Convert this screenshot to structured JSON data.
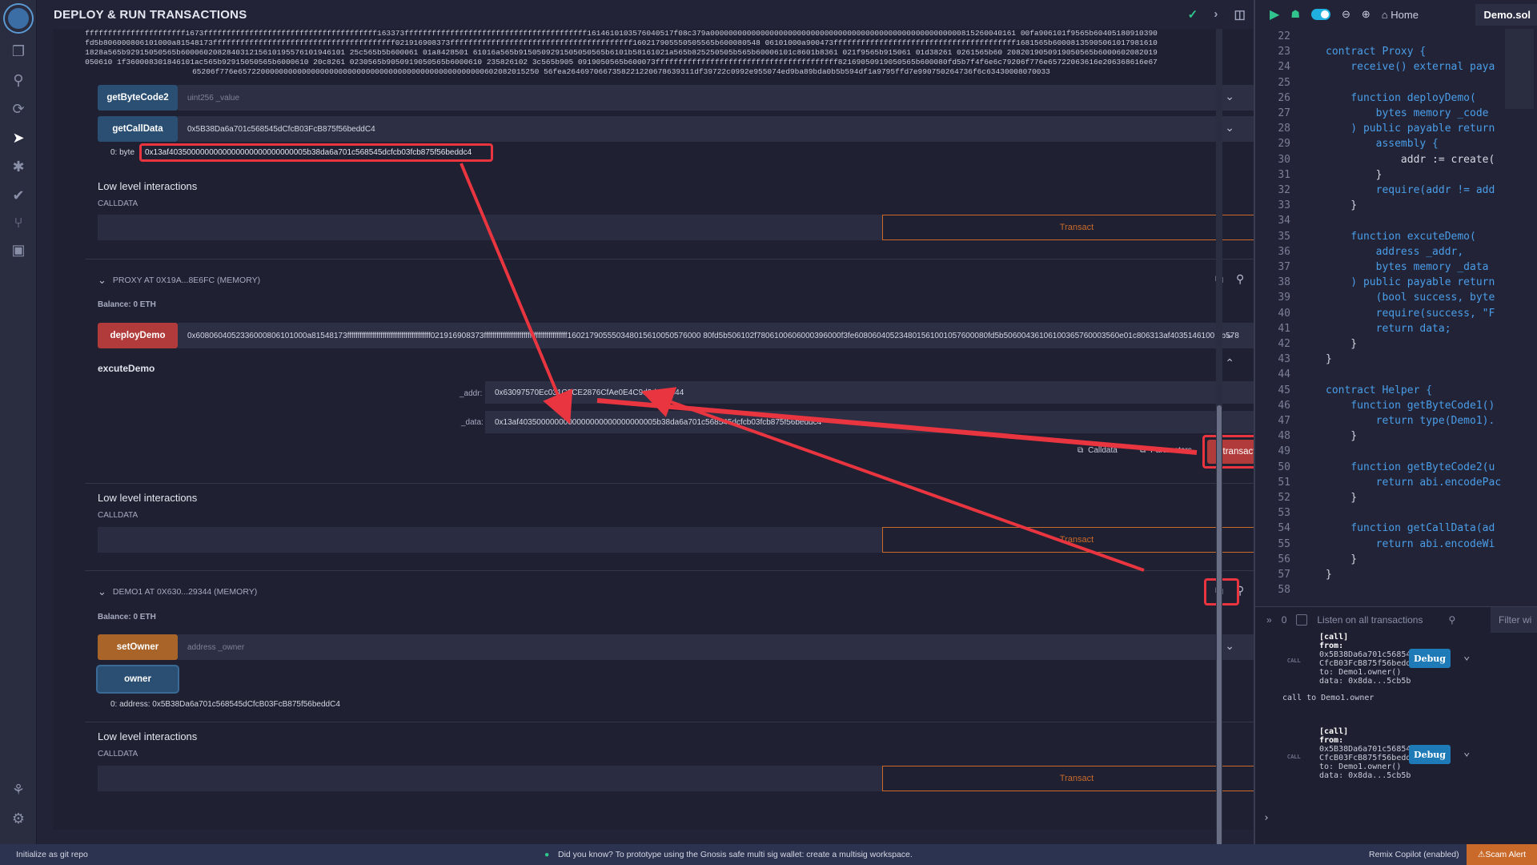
{
  "panel": {
    "title": "DEPLOY & RUN TRANSACTIONS",
    "bytecode_dump": "ffffffffffffffffffffff1673ffffffffffffffffffffffffffffffffffffff163373ffffffffffffffffffffffffffffffffffffffff1614610103576040517f08c379a0000000000000000000000000000000000000000000000000000000815260040161 00fa906101f9565b60405180910390fd5b806000806101000a81548173ffffffffffffffffffffffffffffffffffffffff021916908373ffffffffffffffffffffffffffffffffffffffff160217905550505565b600080548 06101000a900473ffffffffffffffffffffffffffffffffffffffff1681565b600081359050610179816101828a565b92915050565b600060208284031215610195576101946101 25c565b5b600061 01a8428501 61016a565b9150509291505050565b6101b58161021a565b825250505b565b60006101c8601b8361 021f9565b915061 01d38261 0261565b60 2082019050919050565b6000602082019050610 1f360008301846101ac565b92915050565b6000610 20c8261 0230565b9050919050565b6000610 235826102 3c565b905 0919050565b600073ffffffffffffffffffffffffffffffffffffffff82169050919050565b600080fd5b7f4f6e6c79206f776e65722063616e206368616e67 65206f776e657220000000000000000000000000000000000000000000000000602082015250 56fea2646970667358221220678639311df39722c0992e955074ed9ba89bda0b5b594df1a9795ffd7e990750264736f6c63430008070033",
    "getByteCode2": {
      "label": "getByteCode2",
      "placeholder": "uint256 _value"
    },
    "getCallData": {
      "label": "getCallData",
      "value": "0x5B38Da6a701c568545dCfcB03FcB875f56beddC4",
      "output_prefix": "0: byte",
      "output_value": "0x13af4035000000000000000000000000005b38da6a701c568545dcfcb03fcb875f56beddc4"
    },
    "low_level_title": "Low level interactions",
    "calldata_label": "CALLDATA",
    "transact_label": "Transact",
    "proxy": {
      "title": "PROXY AT 0X19A...8E6FC (MEMORY)",
      "balance": "Balance: 0 ETH",
      "deployDemo_label": "deployDemo",
      "deployDemo_value": "0x6080604052336000806101000a81548173ffffffffffffffffffffffffffffffffffffffff021916908373ffffffffffffffffffffffffffffffffffffffff160217905550348015610050576000 80fd5b506102f7806100606000396000f3fe608060405234801561001057600080fd5b50600436106100365760003560e01c806313af4035146100 3b578",
      "excuteDemo_label": "excuteDemo",
      "addr_label": "_addr:",
      "addr_value": "0x63097570Ec031C2CE2876CfAe0E4C9d9dA29344",
      "data_label": "_data:",
      "data_value": "0x13af4035000000000000000000000000005b38da6a701c568545dcfcb03fcb875f56beddc4",
      "calldata_btn": "Calldata",
      "parameters_btn": "Parameters",
      "transact_btn": "transact"
    },
    "demo1": {
      "title": "DEMO1 AT 0X630...29344 (MEMORY)",
      "balance": "Balance: 0 ETH",
      "setOwner_label": "setOwner",
      "setOwner_placeholder": "address _owner",
      "owner_label": "owner",
      "owner_result": "0: address: 0x5B38Da6a701c568545dCfcB03FcB875f56beddC4"
    }
  },
  "editor": {
    "home_tab": "Home",
    "file_tab": "Demo.sol",
    "lines": [
      {
        "n": "22",
        "t": ""
      },
      {
        "n": "23",
        "t": "contract Proxy {"
      },
      {
        "n": "24",
        "t": "    receive() external paya"
      },
      {
        "n": "25",
        "t": ""
      },
      {
        "n": "26",
        "t": "    function deployDemo("
      },
      {
        "n": "27",
        "t": "        bytes memory _code"
      },
      {
        "n": "28",
        "t": "    ) public payable return"
      },
      {
        "n": "29",
        "t": "        assembly {"
      },
      {
        "n": "30",
        "t": "            addr := create("
      },
      {
        "n": "31",
        "t": "        }"
      },
      {
        "n": "32",
        "t": "        require(addr != add"
      },
      {
        "n": "33",
        "t": "    }"
      },
      {
        "n": "34",
        "t": ""
      },
      {
        "n": "35",
        "t": "    function excuteDemo("
      },
      {
        "n": "36",
        "t": "        address _addr,"
      },
      {
        "n": "37",
        "t": "        bytes memory _data"
      },
      {
        "n": "38",
        "t": "    ) public payable return"
      },
      {
        "n": "39",
        "t": "        (bool success, byte"
      },
      {
        "n": "40",
        "t": "        require(success, \"F"
      },
      {
        "n": "41",
        "t": "        return data;"
      },
      {
        "n": "42",
        "t": "    }"
      },
      {
        "n": "43",
        "t": "}"
      },
      {
        "n": "44",
        "t": ""
      },
      {
        "n": "45",
        "t": "contract Helper {"
      },
      {
        "n": "46",
        "t": "    function getByteCode1()"
      },
      {
        "n": "47",
        "t": "        return type(Demo1)."
      },
      {
        "n": "48",
        "t": "    }"
      },
      {
        "n": "49",
        "t": ""
      },
      {
        "n": "50",
        "t": "    function getByteCode2(u"
      },
      {
        "n": "51",
        "t": "        return abi.encodePac"
      },
      {
        "n": "52",
        "t": "    }"
      },
      {
        "n": "53",
        "t": ""
      },
      {
        "n": "54",
        "t": "    function getCallData(ad"
      },
      {
        "n": "55",
        "t": "        return abi.encodeWi"
      },
      {
        "n": "56",
        "t": "    }"
      },
      {
        "n": "57",
        "t": "}"
      },
      {
        "n": "58",
        "t": ""
      }
    ]
  },
  "terminal": {
    "count": "0",
    "listen_label": "Listen on all transactions",
    "filter_placeholder": "Filter wi",
    "log1": {
      "call": "[call]",
      "from_label": "from:",
      "from": "0x5B38Da6a701c568545d",
      "from2": "CfcB03FcB875f56beddC4",
      "to": "to: Demo1.owner()",
      "data": "data: 0x8da...5cb5b",
      "note": "call to Demo1.owner"
    },
    "log2": {
      "call": "[call]",
      "from_label": "from:",
      "from": "0x5B38Da6a701c568545d",
      "from2": "CfcB03FcB875f56beddC4",
      "to": "to: Demo1.owner()",
      "data": "data: 0x8da...5cb5b"
    },
    "debug_label": "Debug",
    "call_tag": "CALL"
  },
  "status": {
    "git": "Initialize as git repo",
    "tip": "Did you know?   To prototype using the Gnosis safe multi sig wallet: create a multisig workspace.",
    "copilot": "Remix Copilot (enabled)",
    "scam": "Scam Alert"
  },
  "colors": {
    "accent_red": "#e8353f",
    "orange": "#c96a2a",
    "blue_btn": "#2a4f73"
  }
}
